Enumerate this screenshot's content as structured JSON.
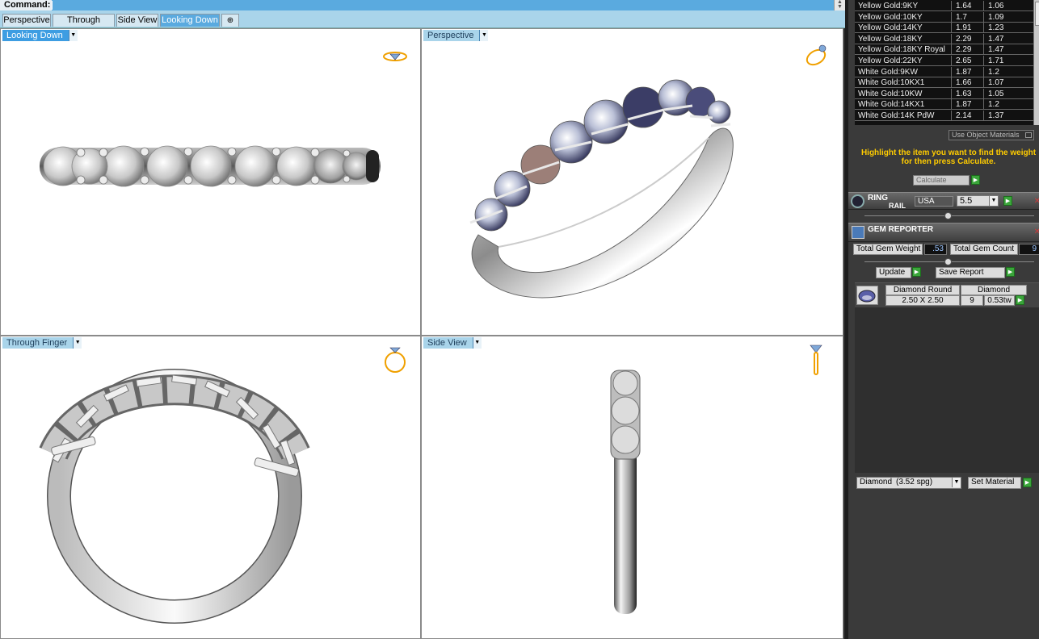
{
  "command": {
    "label": "Command:"
  },
  "tabs": [
    {
      "label": "Perspective",
      "active": false
    },
    {
      "label": "Through Finger",
      "active": false
    },
    {
      "label": "Side View",
      "active": false
    },
    {
      "label": "Looking Down",
      "active": true
    }
  ],
  "add_tab_icon": "plus-icon",
  "viewports": {
    "top_left": {
      "label": "Looking Down"
    },
    "top_right": {
      "label": "Perspective"
    },
    "bottom_left": {
      "label": "Through Finger"
    },
    "bottom_right": {
      "label": "Side View"
    }
  },
  "materials": [
    {
      "name": "Yellow Gold:9KY",
      "v1": "1.64",
      "v2": "1.06"
    },
    {
      "name": "Yellow Gold:10KY",
      "v1": "1.7",
      "v2": "1.09"
    },
    {
      "name": "Yellow Gold:14KY",
      "v1": "1.91",
      "v2": "1.23"
    },
    {
      "name": "Yellow Gold:18KY",
      "v1": "2.29",
      "v2": "1.47"
    },
    {
      "name": "Yellow Gold:18KY Royal",
      "v1": "2.29",
      "v2": "1.47"
    },
    {
      "name": "Yellow Gold:22KY",
      "v1": "2.65",
      "v2": "1.71"
    },
    {
      "name": "White Gold:9KW",
      "v1": "1.87",
      "v2": "1.2"
    },
    {
      "name": "White Gold:10KX1",
      "v1": "1.66",
      "v2": "1.07"
    },
    {
      "name": "White Gold:10KW",
      "v1": "1.63",
      "v2": "1.05"
    },
    {
      "name": "White Gold:14KX1",
      "v1": "1.87",
      "v2": "1.2"
    },
    {
      "name": "White Gold:14K PdW",
      "v1": "2.14",
      "v2": "1.37"
    }
  ],
  "use_object_materials": "Use Object Materials",
  "hint": "Highlight the item you want to find the weight for then press Calculate.",
  "calculate": "Calculate",
  "ring_rail": {
    "title_line1": "RING",
    "title_line2": "RAIL",
    "standard": "USA",
    "size": "5.5"
  },
  "gem_reporter": {
    "title": "GEM REPORTER",
    "total_weight_label": "Total Gem Weight",
    "total_weight_value": ".53",
    "total_count_label": "Total Gem Count",
    "total_count_value": "9",
    "update_label": "Update",
    "save_label": "Save Report",
    "rows": [
      {
        "shape": "Diamond Round",
        "material": "Diamond",
        "size": "2.50 X 2.50",
        "count": "9",
        "weight": "0.53tw"
      }
    ]
  },
  "material_select": {
    "value": "Diamond",
    "spg": "(3.52 spg)",
    "set_label": "Set Material"
  },
  "colors": {
    "accent": "#5aaadf",
    "hint": "#ffcc00",
    "green": "#3aa53a",
    "close": "#cc3b3b",
    "icon": "#f0a000"
  }
}
